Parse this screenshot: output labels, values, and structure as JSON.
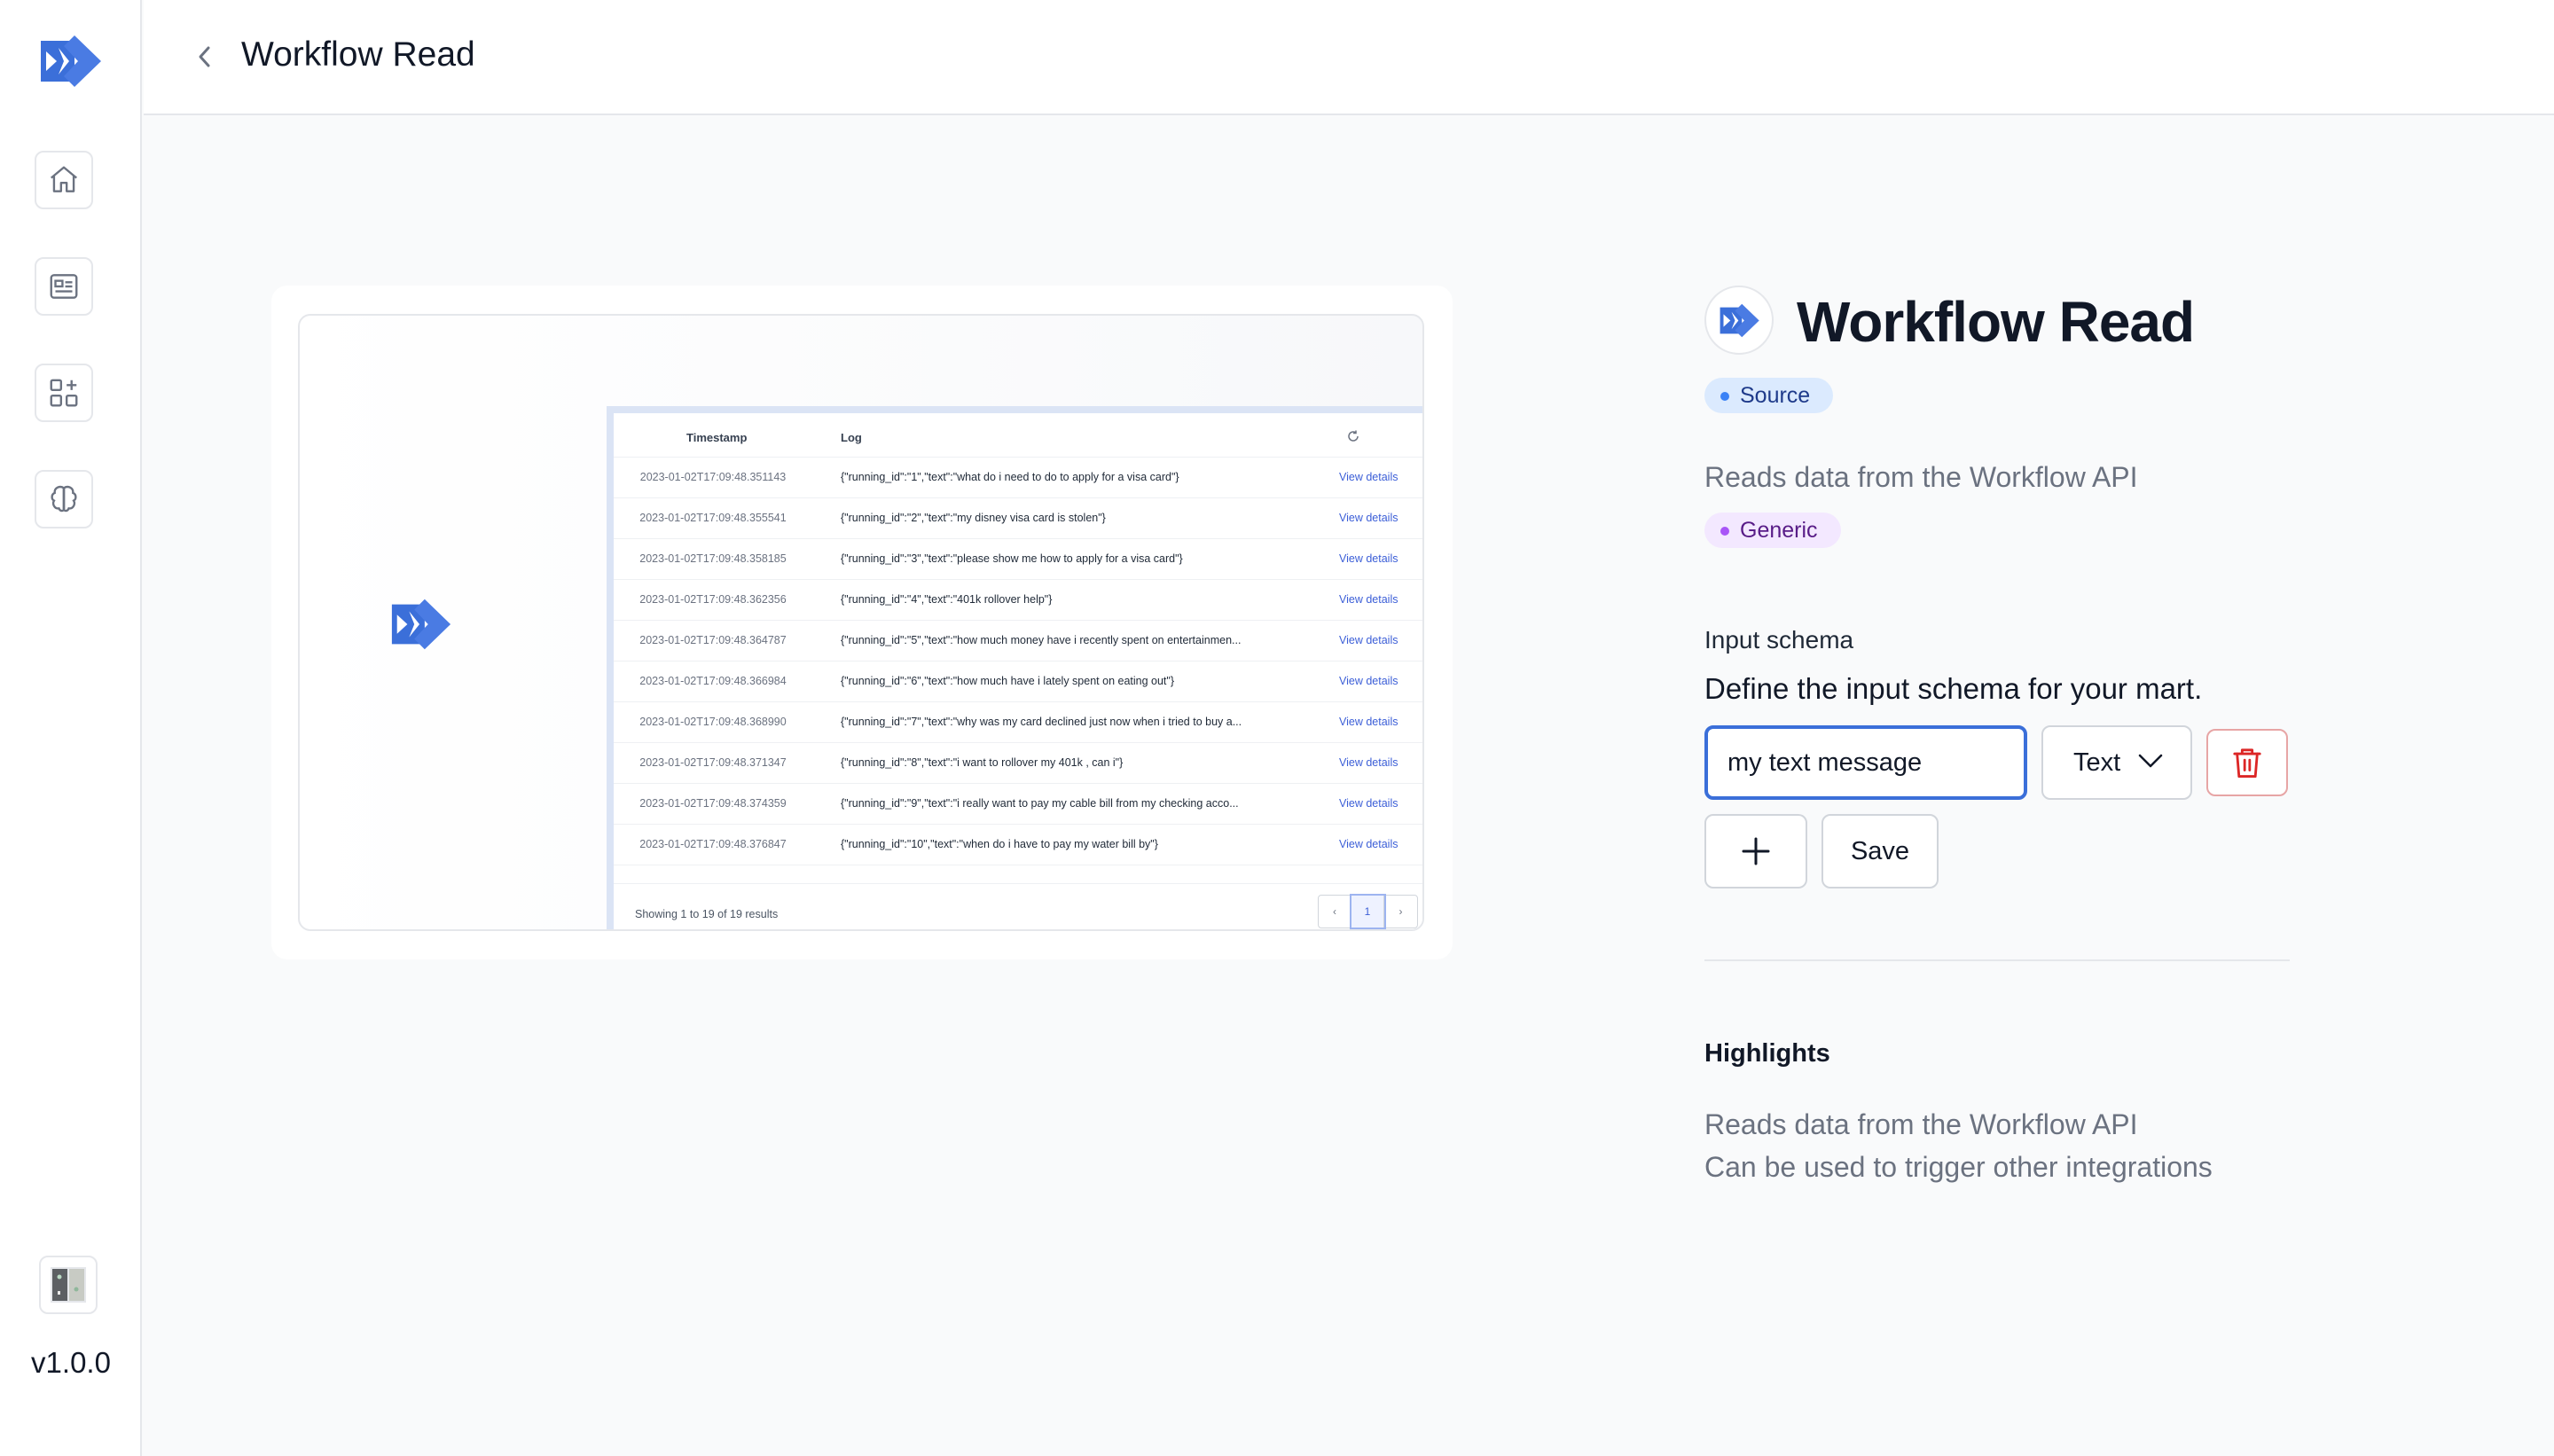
{
  "app": {
    "version": "v1.0.0",
    "accent_color": "#3b6fd9"
  },
  "sidebar": {
    "items": [
      {
        "icon": "home-icon"
      },
      {
        "icon": "id-card-icon"
      },
      {
        "icon": "apps-add-icon"
      },
      {
        "icon": "brain-icon"
      }
    ]
  },
  "header": {
    "title": "Workflow Read"
  },
  "preview": {
    "columns": [
      "Timestamp",
      "Log"
    ],
    "rows": [
      {
        "timestamp": "2023-01-02T17:09:48.351143",
        "log": "{\"running_id\":\"1\",\"text\":\"what do i need to do to apply for a visa card\"}",
        "action": "View details"
      },
      {
        "timestamp": "2023-01-02T17:09:48.355541",
        "log": "{\"running_id\":\"2\",\"text\":\"my disney visa card is stolen\"}",
        "action": "View details"
      },
      {
        "timestamp": "2023-01-02T17:09:48.358185",
        "log": "{\"running_id\":\"3\",\"text\":\"please show me how to apply for a visa card\"}",
        "action": "View details"
      },
      {
        "timestamp": "2023-01-02T17:09:48.362356",
        "log": "{\"running_id\":\"4\",\"text\":\"401k rollover help\"}",
        "action": "View details"
      },
      {
        "timestamp": "2023-01-02T17:09:48.364787",
        "log": "{\"running_id\":\"5\",\"text\":\"how much money have i recently spent on entertainmen...",
        "action": "View details"
      },
      {
        "timestamp": "2023-01-02T17:09:48.366984",
        "log": "{\"running_id\":\"6\",\"text\":\"how much have i lately spent on eating out\"}",
        "action": "View details"
      },
      {
        "timestamp": "2023-01-02T17:09:48.368990",
        "log": "{\"running_id\":\"7\",\"text\":\"why was my card declined just now when i tried to buy a...",
        "action": "View details"
      },
      {
        "timestamp": "2023-01-02T17:09:48.371347",
        "log": "{\"running_id\":\"8\",\"text\":\"i want to rollover my 401k , can i\"}",
        "action": "View details"
      },
      {
        "timestamp": "2023-01-02T17:09:48.374359",
        "log": "{\"running_id\":\"9\",\"text\":\"i really want to pay my cable bill from my checking acco...",
        "action": "View details"
      },
      {
        "timestamp": "2023-01-02T17:09:48.376847",
        "log": "{\"running_id\":\"10\",\"text\":\"when do i have to pay my water bill by\"}",
        "action": "View details"
      }
    ],
    "footer_text": "Showing 1 to 19 of 19 results",
    "pager": {
      "prev": "‹",
      "page": "1",
      "next": "›"
    }
  },
  "detail": {
    "title": "Workflow Read",
    "type_badge": "Source",
    "description": "Reads data from the Workflow API",
    "category_badge": "Generic",
    "input_schema": {
      "label": "Input schema",
      "help": "Define the input schema for your mart.",
      "field_value": "my text message",
      "field_type": "Text",
      "save_label": "Save"
    },
    "highlights": {
      "title": "Highlights",
      "items": [
        "Reads data from the Workflow API",
        "Can be used to trigger other integrations"
      ]
    }
  }
}
